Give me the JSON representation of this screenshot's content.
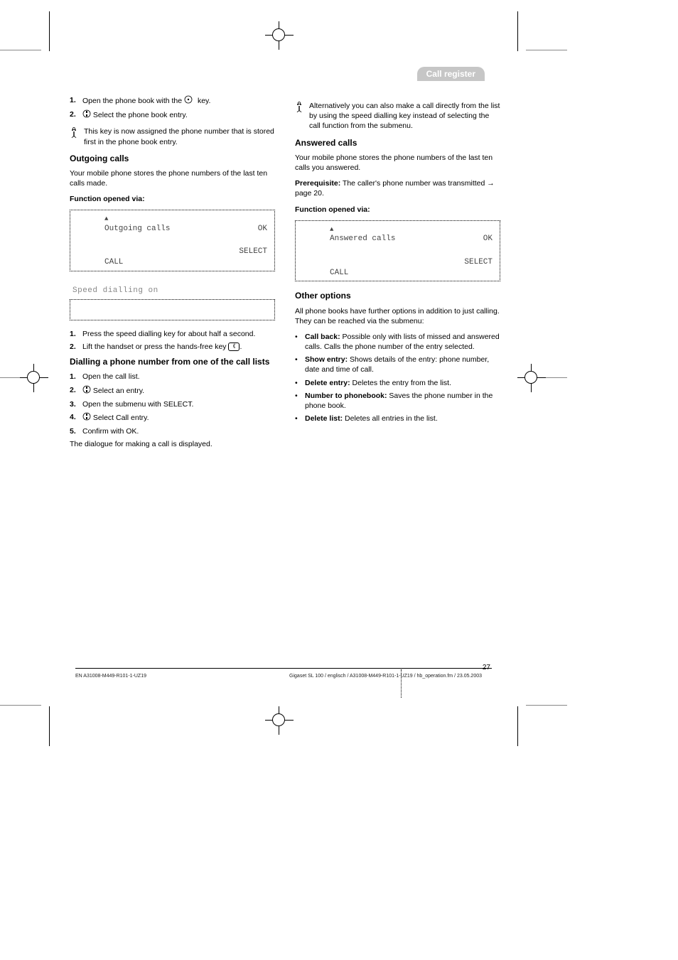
{
  "tab_label": "Call register",
  "page_number": "27",
  "footer_left": "EN A31008-M449-R101-1-UZ19",
  "footer_right": "Gigaset SL 100 / englisch / A31008-M449-R101-1-UZ19 / hb_operation.fm / 23.05.2003",
  "left": {
    "step1_n": "1.",
    "step1_text": "Open the phone book with the         key.",
    "step2_n": "2.",
    "step2_s": "s",
    "step2_text": "Select the phone book entry.",
    "note1": "This key is now assigned the phone number that is stored first in the phone book entry.",
    "outgoing_heading": "Outgoing calls",
    "outgoing_intro": "Your mobile phone stores the phone numbers of the last ten calls made.",
    "outgoing_funclabel": "Function opened via:",
    "lcd1_line1": "Outgoing calls",
    "lcd1_ok": "OK",
    "lcd1_select": "SELECT",
    "lcd1_call": "CALL",
    "speed_label": "Speed dialling on",
    "speed_step1_n": "1.",
    "speed_step1_text": "Press the speed dialling key for about half a second.",
    "speed_step2_n": "2.",
    "speed_step2_text": "Lift the handset or press the hands-free key          .",
    "dial_heading": "Dialling a phone number from one of the call lists",
    "dial_step1_n": "1.",
    "dial_step1_text": "Open the call list.",
    "dial_step2_n": "2.",
    "dial_step2_s": "s",
    "dial_step2_text": "Select an entry.",
    "dial_step3_n": "3.",
    "dial_step3_text": "Open the submenu with SELECT.",
    "dial_step4_n": "4.",
    "dial_step4_s": "s",
    "dial_step4_text": "Select Call entry.",
    "dial_step5_n": "5.",
    "dial_step5_text": "Confirm with OK.",
    "dial_post": "The dialogue for making a call is displayed."
  },
  "right": {
    "note1": "Alternatively you can also make a call directly from the list by using the speed dialling key instead of selecting the call function from the submenu.",
    "answered_heading": "Answered calls",
    "answered_intro": "Your mobile phone stores the phone numbers of the last ten calls you answered.",
    "answered_prereq_label": "Prerequisite:",
    "answered_prereq_text": "The caller's phone number was transmitted  page 20.",
    "answered_funclabel": "Function opened via:",
    "lcd2_line1": "Answered calls",
    "lcd2_ok": "OK",
    "lcd2_select": "SELECT",
    "lcd2_call": "CALL",
    "options_heading": "Other options",
    "options_intro": "All phone books have further options in addition to just calling. They can be reached via the submenu:",
    "opt1_t": "Call back:",
    "opt1_d": "Possible only with lists of missed and answered calls. Calls the phone number of the entry selected.",
    "opt2_t": "Show entry:",
    "opt2_d": "Shows details of the entry: phone number, date and time of call.",
    "opt3_t": "Delete entry:",
    "opt3_d": "Deletes the entry from the list.",
    "opt4_t": "Number to phonebook:",
    "opt4_d": "Saves the phone number in the phone book.",
    "opt5_t": "Delete list:",
    "opt5_d": "Deletes all entries in the list."
  }
}
